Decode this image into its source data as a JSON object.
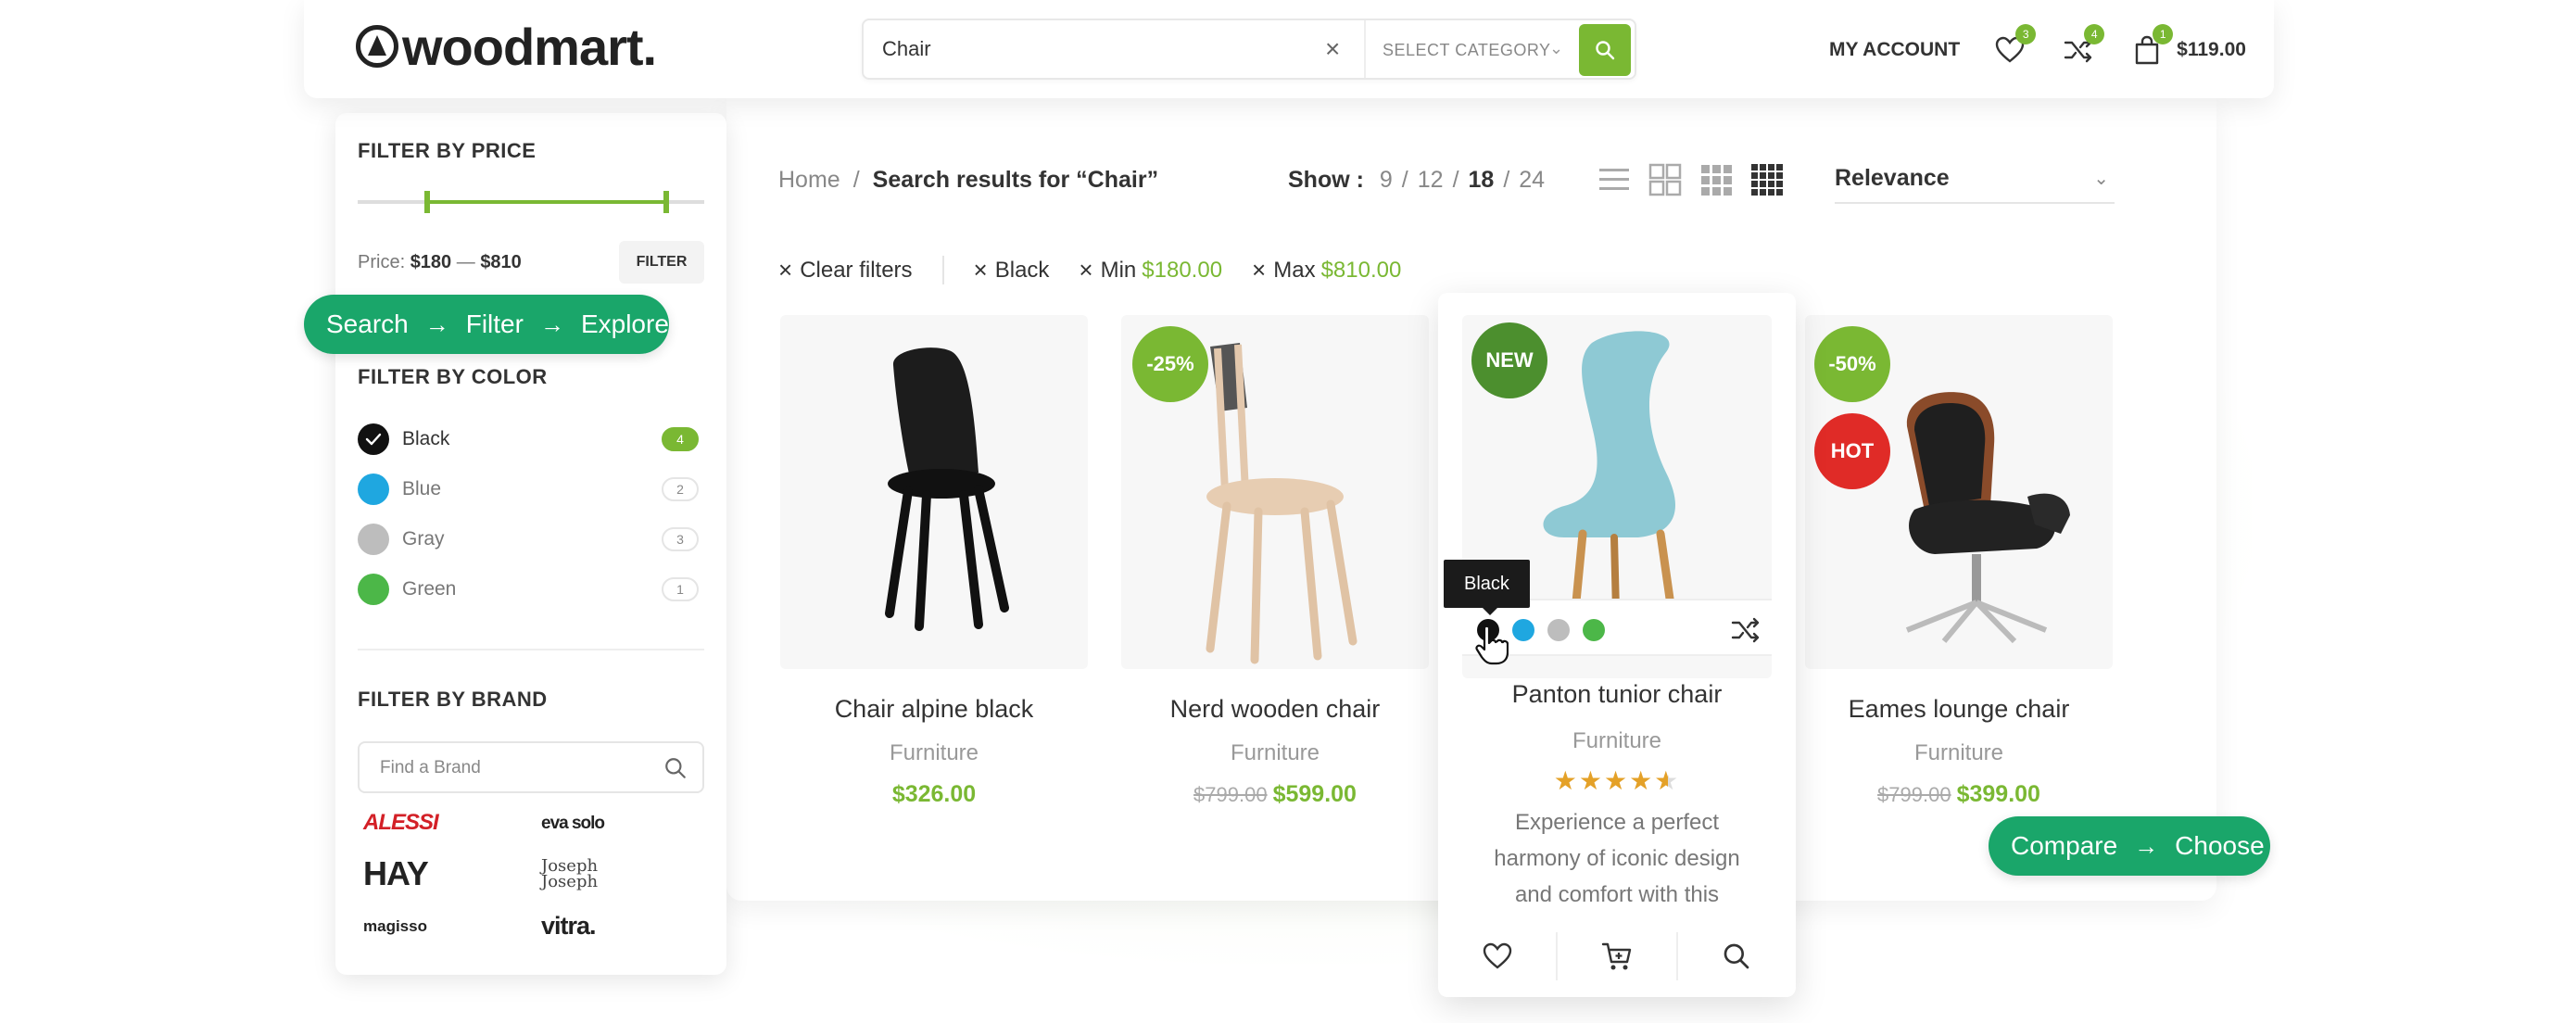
{
  "header": {
    "logo": "woodmart.",
    "search_value": "Chair",
    "select_category": "SELECT CATEGORY",
    "my_account": "MY ACCOUNT",
    "wishlist_count": "3",
    "compare_count": "4",
    "cart_count": "1",
    "cart_total": "$119.00"
  },
  "sidebar": {
    "price_heading": "FILTER BY PRICE",
    "price_label": "Price:",
    "price_min": "$180",
    "price_dash": "—",
    "price_max": "$810",
    "filter_button": "FILTER",
    "color_heading": "FILTER BY COLOR",
    "colors": [
      {
        "name": "Black",
        "count": "4",
        "hex": "#111111"
      },
      {
        "name": "Blue",
        "count": "2",
        "hex": "#1fa7e0"
      },
      {
        "name": "Gray",
        "count": "3",
        "hex": "#bdbdbd"
      },
      {
        "name": "Green",
        "count": "1",
        "hex": "#4cb748"
      }
    ],
    "brand_heading": "FILTER BY BRAND",
    "brand_placeholder": "Find a Brand",
    "brands": [
      "ALESSI",
      "eva solo",
      "HAY",
      "Joseph Joseph",
      "magisso",
      "vitra."
    ]
  },
  "pills": {
    "left": [
      "Search",
      "Filter",
      "Explore"
    ],
    "right": [
      "Compare",
      "Choose"
    ]
  },
  "toolbar": {
    "crumb_home": "Home",
    "crumb_sep": "/",
    "crumb_current": "Search results for “Chair”",
    "show_label": "Show :",
    "show_options": [
      "9",
      "12",
      "18",
      "24"
    ],
    "sort_value": "Relevance"
  },
  "active_filters": {
    "clear": "Clear filters",
    "color": "Black",
    "min_label": "Min",
    "min_value": "$180.00",
    "max_label": "Max",
    "max_value": "$810.00"
  },
  "products": [
    {
      "title": "Chair alpine black",
      "category": "Furniture",
      "price": "$326.00",
      "old_price": ""
    },
    {
      "title": "Nerd wooden chair",
      "category": "Furniture",
      "price": "$599.00",
      "old_price": "$799.00",
      "label": "-25%"
    },
    {
      "title": "Panton tunior chair",
      "category": "Furniture",
      "label": "NEW",
      "tooltip": "Black",
      "rating": 4.5,
      "description": "Experience a perfect harmony of iconic design and comfort with this"
    },
    {
      "title": "Eames lounge chair",
      "category": "Furniture",
      "price": "$399.00",
      "old_price": "$799.00",
      "label": "-50%",
      "label2": "HOT"
    }
  ],
  "colors": {
    "accent": "#7ab833",
    "pill": "#1aa66a",
    "hot": "#e02b27"
  }
}
